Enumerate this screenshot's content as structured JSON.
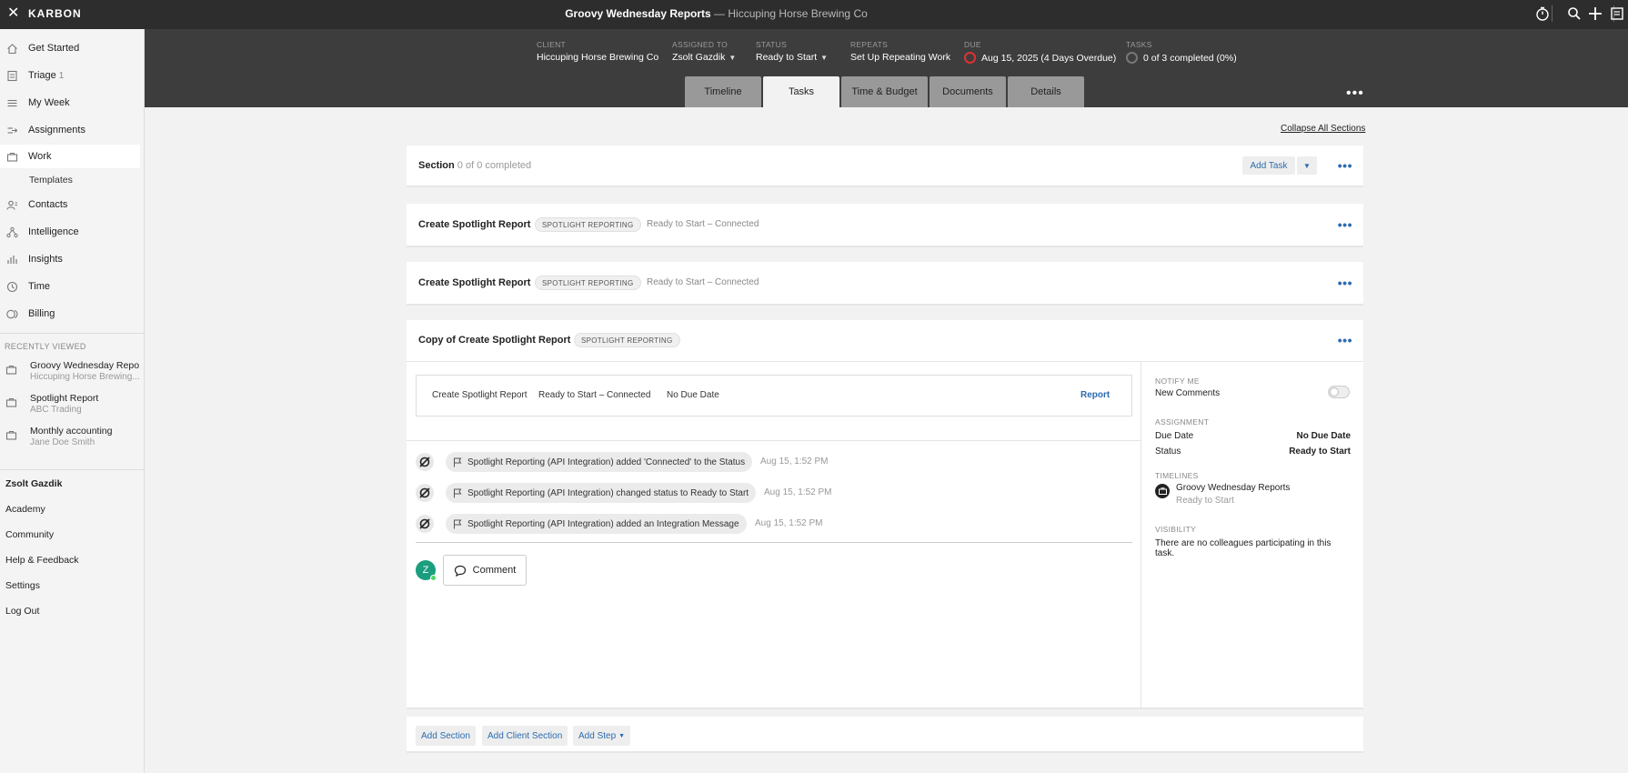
{
  "topbar": {
    "brand": "KARBON",
    "work_title": "Groovy Wednesday Reports",
    "client_suffix": "— Hiccuping Horse Brewing Co"
  },
  "sidebar": {
    "items": [
      {
        "label": "Get Started",
        "icon": "home-icon"
      },
      {
        "label": "Triage",
        "count": "1",
        "icon": "triage-icon"
      },
      {
        "label": "My Week",
        "icon": "list-icon"
      },
      {
        "label": "Assignments",
        "icon": "assignments-icon"
      },
      {
        "label": "Work",
        "icon": "briefcase-icon"
      },
      {
        "label": "Contacts",
        "icon": "contacts-icon"
      },
      {
        "label": "Intelligence",
        "icon": "intelligence-icon"
      },
      {
        "label": "Insights",
        "icon": "bar-chart-icon"
      },
      {
        "label": "Time",
        "icon": "clock-icon"
      },
      {
        "label": "Billing",
        "icon": "billing-icon"
      }
    ],
    "sub_templates": "Templates",
    "recently_viewed_heading": "RECENTLY VIEWED",
    "recent": [
      {
        "title": "Groovy Wednesday Repo...",
        "subtitle": "Hiccuping Horse Brewing..."
      },
      {
        "title": "Spotlight Report",
        "subtitle": "ABC Trading"
      },
      {
        "title": "Monthly accounting",
        "subtitle": "Jane Doe Smith"
      }
    ],
    "bottom_links": [
      "Zsolt Gazdik",
      "Academy",
      "Community",
      "Help & Feedback",
      "Settings",
      "Log Out"
    ]
  },
  "header": {
    "client_label": "CLIENT",
    "client_value": "Hiccuping Horse Brewing Co",
    "assigned_label": "ASSIGNED TO",
    "assigned_value": "Zsolt Gazdik",
    "status_label": "STATUS",
    "status_value": "Ready to Start",
    "repeats_label": "REPEATS",
    "repeats_value": "Set Up Repeating Work",
    "due_label": "DUE",
    "due_value": "Aug 15, 2025 (4 Days Overdue)",
    "tasks_label": "TASKS",
    "tasks_value": "0 of 3 completed (0%)",
    "tabs": [
      "Timeline",
      "Tasks",
      "Time & Budget",
      "Documents",
      "Details"
    ],
    "active_tab": "Tasks"
  },
  "main": {
    "collapse_all": "Collapse All Sections",
    "section": {
      "title": "Section",
      "progress": "0 of 0 completed",
      "add_task": "Add Task"
    },
    "tasks": [
      {
        "title": "Create Spotlight Report",
        "tag": "SPOTLIGHT REPORTING",
        "status": "Ready to Start – Connected"
      },
      {
        "title": "Create Spotlight Report",
        "tag": "SPOTLIGHT REPORTING",
        "status": "Ready to Start – Connected"
      }
    ],
    "expanded": {
      "title": "Copy of Create Spotlight Report",
      "tag": "SPOTLIGHT REPORTING",
      "linked": {
        "name": "Create Spotlight Report",
        "status": "Ready to Start – Connected",
        "due": "No Due Date",
        "action": "Report"
      },
      "activity": [
        {
          "text": "Spotlight Reporting (API Integration) added 'Connected' to the Status",
          "time": "Aug 15, 1:52 PM"
        },
        {
          "text": "Spotlight Reporting (API Integration) changed status to Ready to Start",
          "time": "Aug 15, 1:52 PM"
        },
        {
          "text": "Spotlight Reporting (API Integration) added an Integration Message",
          "time": "Aug 15, 1:52 PM"
        }
      ],
      "avatar_initial": "Z",
      "comment_label": "Comment",
      "panel": {
        "notify_heading": "NOTIFY ME",
        "new_comments": "New Comments",
        "new_comments_on": false,
        "assignment_heading": "ASSIGNMENT",
        "due_date_label": "Due Date",
        "due_date_value": "No Due Date",
        "status_label": "Status",
        "status_value": "Ready to Start",
        "timelines_heading": "TIMELINES",
        "timeline_name": "Groovy Wednesday Reports",
        "timeline_status": "Ready to Start",
        "visibility_heading": "VISIBILITY",
        "visibility_text": "There are no colleagues participating in this task."
      }
    },
    "footer": {
      "add_section": "Add Section",
      "add_client_section": "Add Client Section",
      "add_step": "Add Step"
    }
  },
  "colors": {
    "accent": "#2b6cb0",
    "topbar": "#2d2d2d",
    "header": "#3d3d3d",
    "overdue": "#e03131"
  }
}
